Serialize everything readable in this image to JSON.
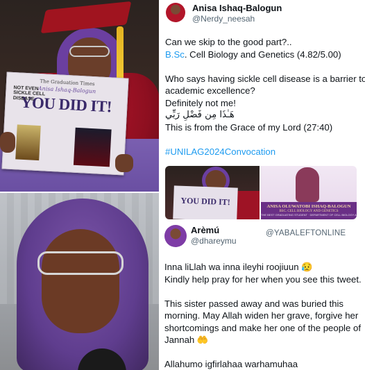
{
  "tweet1": {
    "author_name": "Anisa Ishaq-Balogun",
    "author_handle": "@Nerdy_neesah",
    "line1": "Can we skip to the good part?..",
    "line2_link": "B.Sc",
    "line2_rest": ". Cell Biology and Genetics (4.82/5.00)",
    "line3": "Who says having sickle cell disease is a barrier to",
    "line4": "academic excellence?",
    "line5": "Definitely not me!",
    "line6_arabic": "هَـٰذَا مِن فَضْلِ رَبِّي",
    "line7": "This is from the Grace of my Lord (27:40)",
    "hashtag": "#UNILAG2024Convocation"
  },
  "newspaper": {
    "masthead": "The Graduation Times",
    "subhead": "NOT EVEN SICKLE CELL DISEASE",
    "name": "Anisa Ishaq-Balogun",
    "headline": "YOU DID IT!"
  },
  "media_right": {
    "banner_name": "ANISA OLUWATOBI ISHAQ-BALOGUN",
    "banner_degree": "BSC. CELL BIOLOGY AND GENETICS",
    "banner_small": "THE BEST GRADUATING STUDENT · DEPARTMENT OF CELL BIOLOGY AND GENETICS"
  },
  "tweet2": {
    "author_name": "Arèmú",
    "author_handle": "@dhareymu",
    "watermark": "@YABALEFTONLINE",
    "line1": "Inna liLlah wa inna ileyhi roojiuun 😥",
    "line2": "Kindly help pray for her when you see this tweet.",
    "line3": "This sister passed away and was buried this",
    "line4": "morning. May Allah widen her grave, forgive her",
    "line5": "shortcomings and make her one of the people of",
    "line6": "Jannah 🤲",
    "line7": "Allahumo igfirlahaa warhamuhaa"
  }
}
